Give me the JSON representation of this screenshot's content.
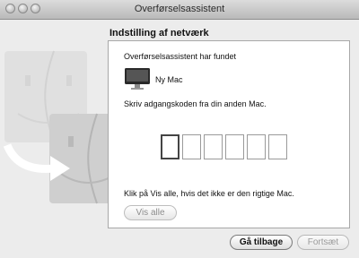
{
  "window": {
    "title": "Overførselsassistent"
  },
  "panel": {
    "heading": "Indstilling af netværk",
    "found_label": "Overførselsassistent har fundet",
    "mac_name": "Ny Mac",
    "instruction": "Skriv adgangskoden fra din anden Mac.",
    "code_boxes": [
      "",
      "",
      "",
      "",
      "",
      ""
    ],
    "hint": "Klik på Vis alle, hvis det ikke er den rigtige Mac.",
    "show_all_label": "Vis alle"
  },
  "footer": {
    "back_label": "Gå tilbage",
    "continue_label": "Fortsæt"
  },
  "icons": {
    "traffic_lights": [
      "close-icon",
      "minimize-icon",
      "zoom-icon"
    ],
    "computer": "imac-icon",
    "finder": "finder-face-icon",
    "arrow": "curved-arrow-icon"
  }
}
